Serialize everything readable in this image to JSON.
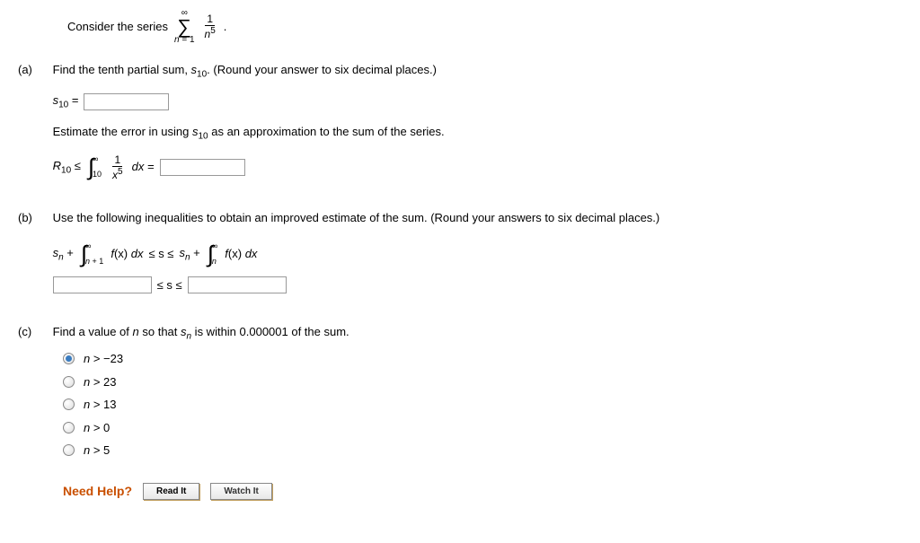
{
  "intro_text": "Consider the series",
  "sigma_top": "∞",
  "sigma_bottom_var": "n",
  "sigma_bottom_eq": " = 1",
  "frac_num": "1",
  "frac_den_var": "n",
  "frac_den_exp": "5",
  "period": ".",
  "part_a": {
    "label": "(a)",
    "text": "Find the tenth partial sum, ",
    "s10_var": "s",
    "s10_sub": "10",
    "text2": ". (Round your answer to six decimal places.)",
    "s10_label1": "s",
    "s10_label_sub": "10",
    "s10_equals": " = ",
    "est_text1": "Estimate the error in using ",
    "est_s": "s",
    "est_sub": "10",
    "est_text2": " as an approximation to the sum of the series.",
    "r10_var": "R",
    "r10_sub": "10",
    "r10_le": " ≤ ",
    "int_top": "∞",
    "int_bot": "10",
    "int_frac_num": "1",
    "int_frac_den_var": "x",
    "int_frac_den_exp": "5",
    "dx_eq": " dx = "
  },
  "part_b": {
    "label": "(b)",
    "text": "Use the following inequalities to obtain an improved estimate of the sum. (Round your answers to six decimal places.)",
    "sn_var": "s",
    "sn_sub": "n",
    "plus": " + ",
    "int1_top": "∞",
    "int1_bot_var": "n",
    "int1_bot_plus": " + 1",
    "fx": "f",
    "fx_arg": "(x) ",
    "dx": "dx",
    "le_s_le": "  ≤  s  ≤  ",
    "int2_top": "∞",
    "int2_bot": "n",
    "middle": " ≤ s ≤ "
  },
  "part_c": {
    "label": "(c)",
    "text1": "Find a value of ",
    "n_var": "n",
    "text2": " so that ",
    "sn_var": "s",
    "sn_sub": "n",
    "text3": " is within 0.000001 of the sum.",
    "options": [
      {
        "var": "n",
        "op": " > −23",
        "selected": true
      },
      {
        "var": "n",
        "op": " > 23",
        "selected": false
      },
      {
        "var": "n",
        "op": " > 13",
        "selected": false
      },
      {
        "var": "n",
        "op": " > 0",
        "selected": false
      },
      {
        "var": "n",
        "op": " > 5",
        "selected": false
      }
    ]
  },
  "help": {
    "label": "Need Help?",
    "read": "Read It",
    "watch": "Watch It"
  }
}
